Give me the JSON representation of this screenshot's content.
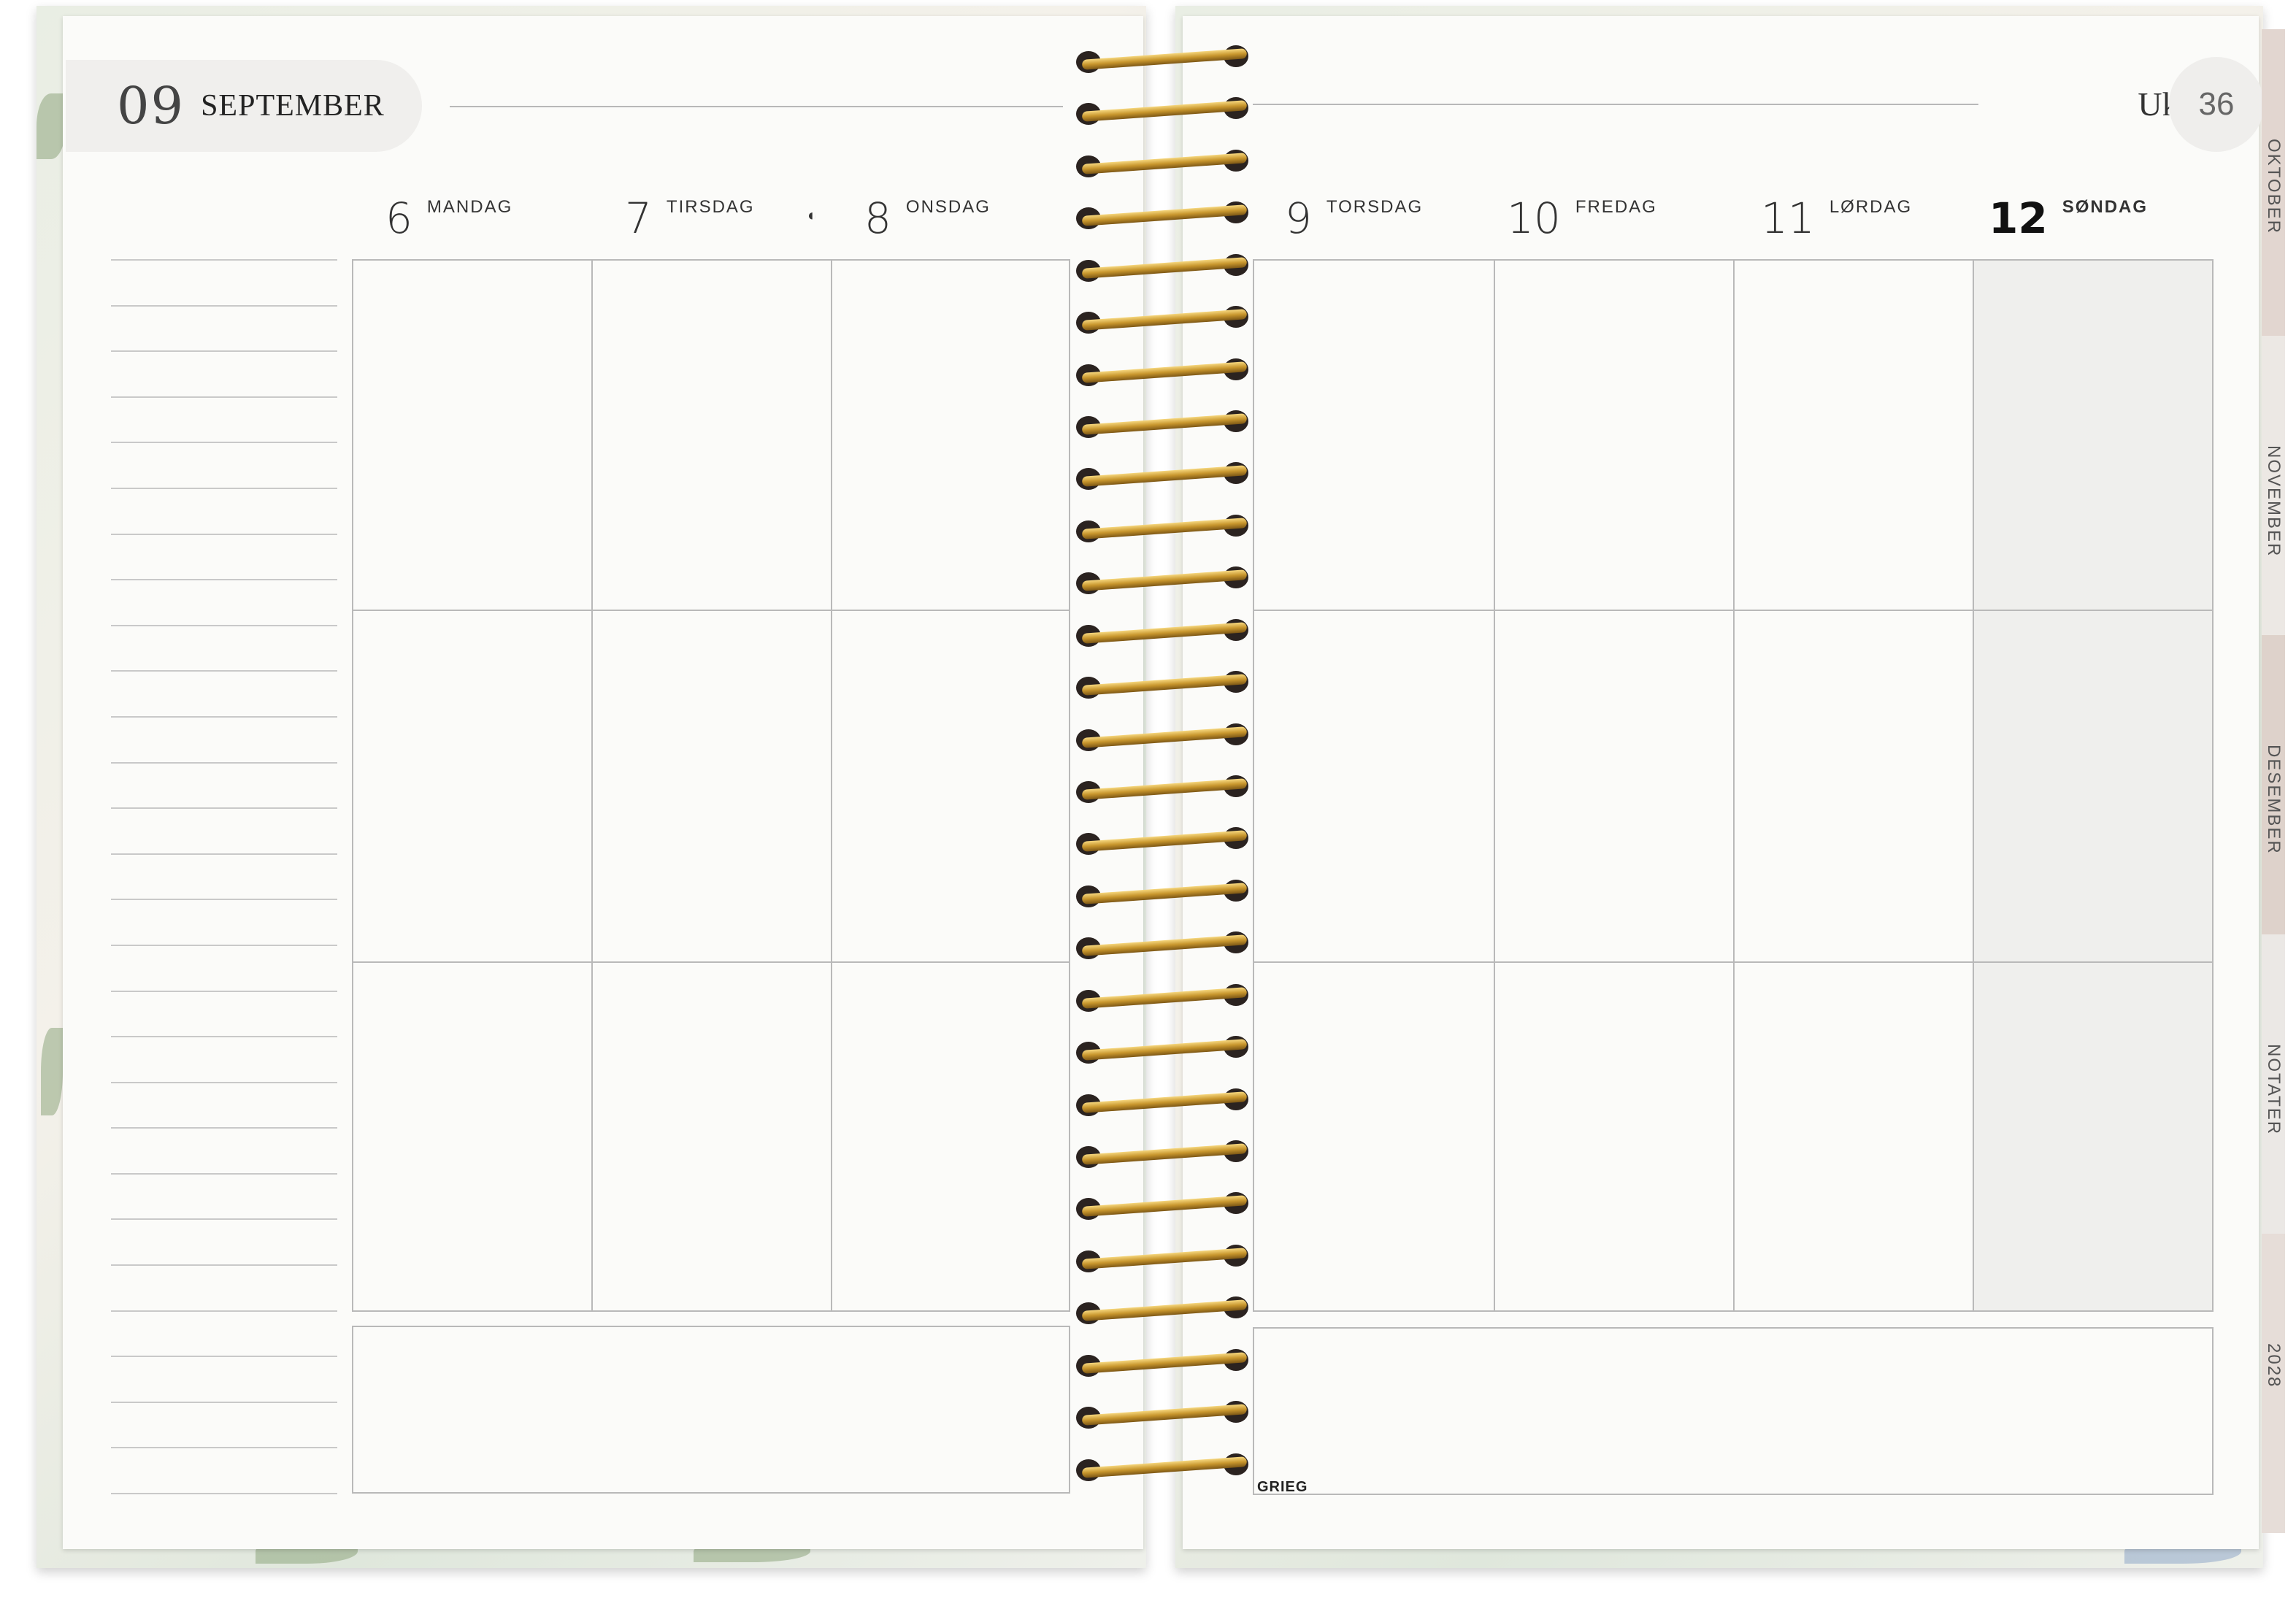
{
  "header": {
    "month_number": "09",
    "month_name": "SEPTEMBER",
    "week_label": "Uke",
    "week_number": "36"
  },
  "days_left": [
    {
      "num": "6",
      "name": "MANDAG"
    },
    {
      "num": "7",
      "name": "TIRSDAG"
    },
    {
      "num": "8",
      "name": "ONSDAG"
    }
  ],
  "days_right": [
    {
      "num": "9",
      "name": "TORSDAG"
    },
    {
      "num": "10",
      "name": "FREDAG"
    },
    {
      "num": "11",
      "name": "LØRDAG"
    },
    {
      "num": "12",
      "name": "SØNDAG"
    }
  ],
  "moon_phase_icon": "half-moon-icon",
  "tabs": [
    "OKTOBER",
    "NOVEMBER",
    "DESEMBER",
    "NOTATER",
    "2028"
  ],
  "brand": "GRIEG",
  "colors": {
    "paper": "#fbfbf9",
    "grid_line": "#b9b9b9",
    "sunday_shade": "#efefed",
    "wire_gold": "#c8962d"
  }
}
